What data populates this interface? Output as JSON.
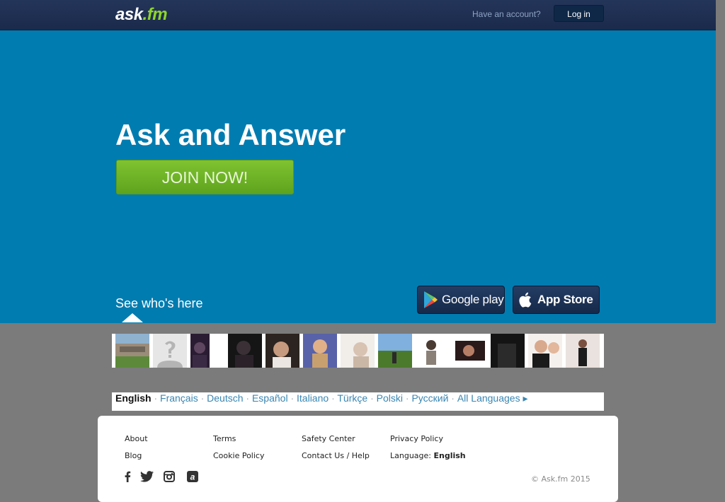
{
  "header": {
    "logo_main": "ask",
    "logo_dot": ".",
    "logo_tld": "fm",
    "have_account": "Have an account?",
    "login_label": "Log in"
  },
  "hero": {
    "headline": "Ask and Answer",
    "join_label": "JOIN NOW!",
    "see_who": "See who's here",
    "google_play_label": "Google play",
    "app_store_label": "App Store"
  },
  "photos": [
    {
      "icon": "building-photo"
    },
    {
      "icon": "default-avatar"
    },
    {
      "icon": "profile-photo"
    },
    {
      "icon": "profile-photo"
    },
    {
      "icon": "profile-photo"
    },
    {
      "icon": "profile-photo"
    },
    {
      "icon": "profile-photo"
    },
    {
      "icon": "landscape-photo"
    },
    {
      "icon": "profile-photo"
    },
    {
      "icon": "profile-photo"
    },
    {
      "icon": "profile-photo"
    },
    {
      "icon": "profile-photo"
    },
    {
      "icon": "profile-photo"
    }
  ],
  "languages": {
    "current": "English",
    "items": [
      "Français",
      "Deutsch",
      "Español",
      "Italiano",
      "Türkçe",
      "Polski",
      "Русский"
    ],
    "all": "All Languages ▸"
  },
  "footer": {
    "about": "About",
    "blog": "Blog",
    "terms": "Terms",
    "cookie_policy": "Cookie Policy",
    "safety_center": "Safety Center",
    "contact_help": "Contact Us / Help",
    "privacy_policy": "Privacy Policy",
    "language_label": "Language:",
    "language_value": "English",
    "copyright": "© Ask.fm 2015"
  },
  "colors": {
    "header": "#1f3052",
    "hero": "#017cb0",
    "join_button": "#6fb52a",
    "page_bg": "#7b7b7b",
    "link": "#3a86b2",
    "logo_accent": "#8ed52b"
  }
}
